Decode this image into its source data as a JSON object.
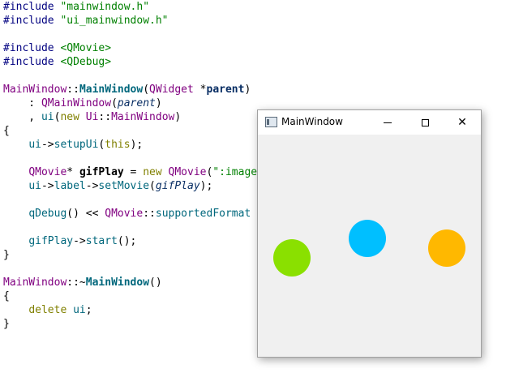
{
  "code_lines": [
    [
      {
        "t": "#include ",
        "c": "pp"
      },
      {
        "t": "\"mainwindow.h\"",
        "c": "str"
      }
    ],
    [
      {
        "t": "#include ",
        "c": "pp"
      },
      {
        "t": "\"ui_mainwindow.h\"",
        "c": "str"
      }
    ],
    [],
    [
      {
        "t": "#include ",
        "c": "pp"
      },
      {
        "t": "<QMovie>",
        "c": "str"
      }
    ],
    [
      {
        "t": "#include ",
        "c": "pp"
      },
      {
        "t": "<QDebug>",
        "c": "str"
      }
    ],
    [],
    [
      {
        "t": "MainWindow",
        "c": "cls"
      },
      {
        "t": "::",
        "c": "punc"
      },
      {
        "t": "MainWindow",
        "c": "fnb"
      },
      {
        "t": "(",
        "c": "punc"
      },
      {
        "t": "QWidget",
        "c": "cls"
      },
      {
        "t": " *",
        "c": "punc"
      },
      {
        "t": "parent",
        "c": "parb"
      },
      {
        "t": ")",
        "c": "punc"
      }
    ],
    [
      {
        "t": "    : ",
        "c": "punc"
      },
      {
        "t": "QMainWindow",
        "c": "cls"
      },
      {
        "t": "(",
        "c": "punc"
      },
      {
        "t": "parent",
        "c": "par"
      },
      {
        "t": ")",
        "c": "punc"
      }
    ],
    [
      {
        "t": "    , ",
        "c": "punc"
      },
      {
        "t": "ui",
        "c": "fn"
      },
      {
        "t": "(",
        "c": "punc"
      },
      {
        "t": "new",
        "c": "kw"
      },
      {
        "t": " ",
        "c": "punc"
      },
      {
        "t": "Ui",
        "c": "cls"
      },
      {
        "t": "::",
        "c": "punc"
      },
      {
        "t": "MainWindow",
        "c": "cls"
      },
      {
        "t": ")",
        "c": "punc"
      }
    ],
    [
      {
        "t": "{",
        "c": "punc"
      }
    ],
    [
      {
        "t": "    ",
        "c": "punc"
      },
      {
        "t": "ui",
        "c": "fn"
      },
      {
        "t": "->",
        "c": "punc"
      },
      {
        "t": "setupUi",
        "c": "fn"
      },
      {
        "t": "(",
        "c": "punc"
      },
      {
        "t": "this",
        "c": "kw"
      },
      {
        "t": ");",
        "c": "punc"
      }
    ],
    [],
    [
      {
        "t": "    ",
        "c": "punc"
      },
      {
        "t": "QMovie",
        "c": "cls"
      },
      {
        "t": "* ",
        "c": "punc"
      },
      {
        "t": "gifPlay",
        "c": "var"
      },
      {
        "t": " = ",
        "c": "punc"
      },
      {
        "t": "new",
        "c": "kw"
      },
      {
        "t": " ",
        "c": "punc"
      },
      {
        "t": "QMovie",
        "c": "cls"
      },
      {
        "t": "(",
        "c": "punc"
      },
      {
        "t": "\":image",
        "c": "str"
      }
    ],
    [
      {
        "t": "    ",
        "c": "punc"
      },
      {
        "t": "ui",
        "c": "fn"
      },
      {
        "t": "->",
        "c": "punc"
      },
      {
        "t": "label",
        "c": "fn"
      },
      {
        "t": "->",
        "c": "punc"
      },
      {
        "t": "setMovie",
        "c": "fn"
      },
      {
        "t": "(",
        "c": "punc"
      },
      {
        "t": "gifPlay",
        "c": "par"
      },
      {
        "t": ");",
        "c": "punc"
      }
    ],
    [],
    [
      {
        "t": "    ",
        "c": "punc"
      },
      {
        "t": "qDebug",
        "c": "fn"
      },
      {
        "t": "() << ",
        "c": "punc"
      },
      {
        "t": "QMovie",
        "c": "cls"
      },
      {
        "t": "::",
        "c": "punc"
      },
      {
        "t": "supportedFormat",
        "c": "fn"
      }
    ],
    [],
    [
      {
        "t": "    ",
        "c": "punc"
      },
      {
        "t": "gifPlay",
        "c": "fn"
      },
      {
        "t": "->",
        "c": "punc"
      },
      {
        "t": "start",
        "c": "fn"
      },
      {
        "t": "();",
        "c": "punc"
      }
    ],
    [
      {
        "t": "}",
        "c": "punc"
      }
    ],
    [],
    [
      {
        "t": "MainWindow",
        "c": "cls"
      },
      {
        "t": "::~",
        "c": "punc"
      },
      {
        "t": "MainWindow",
        "c": "fnb"
      },
      {
        "t": "()",
        "c": "punc"
      }
    ],
    [
      {
        "t": "{",
        "c": "punc"
      }
    ],
    [
      {
        "t": "    ",
        "c": "punc"
      },
      {
        "t": "delete",
        "c": "kw"
      },
      {
        "t": " ",
        "c": "punc"
      },
      {
        "t": "ui",
        "c": "fn"
      },
      {
        "t": ";",
        "c": "punc"
      }
    ],
    [
      {
        "t": "}",
        "c": "punc"
      }
    ]
  ],
  "window": {
    "title": "MainWindow",
    "app_icon": "qt-window-icon",
    "controls": {
      "minimize": "minimize-icon",
      "maximize": "maximize-icon",
      "close": "close-icon",
      "close_glyph": "✕"
    }
  },
  "animation": {
    "balls": [
      {
        "name": "green-ball",
        "color": "#8ae000"
      },
      {
        "name": "blue-ball",
        "color": "#00bfff"
      },
      {
        "name": "orange-ball",
        "color": "#ffb800"
      }
    ]
  }
}
